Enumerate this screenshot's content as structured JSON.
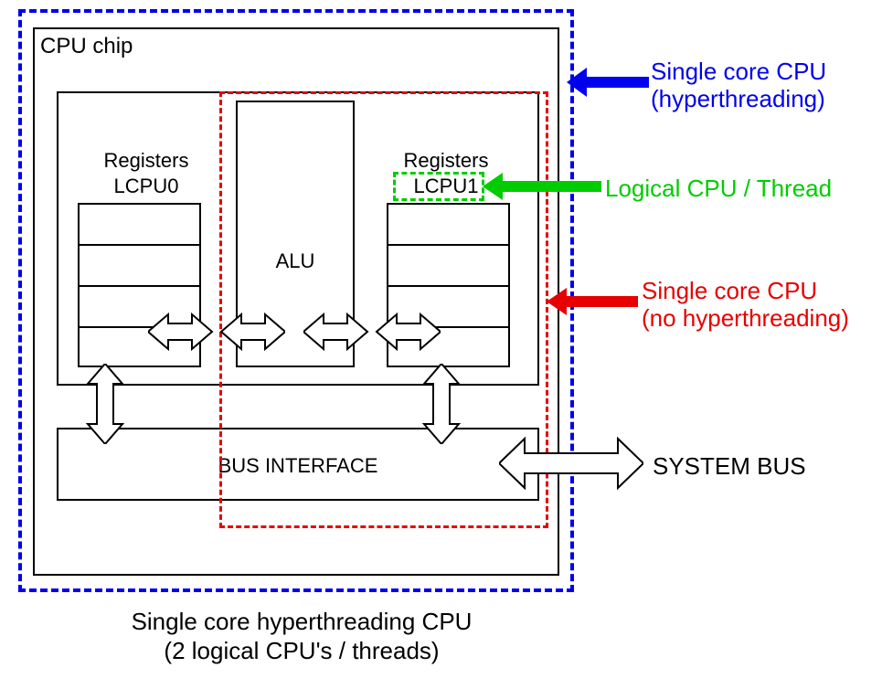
{
  "title": "CPU chip",
  "reg0_label_line1": "Registers",
  "reg0_label_line2": "LCPU0",
  "reg1_label_line1": "Registers",
  "reg1_label_line2": "LCPU1",
  "alu_label": "ALU",
  "bus_interface_label": "BUS INTERFACE",
  "system_bus_label": "SYSTEM BUS",
  "caption_line1": "Single core hyperthreading CPU",
  "caption_line2": "(2 logical CPU's / threads)",
  "annot_blue_line1": "Single core CPU",
  "annot_blue_line2": "(hyperthreading)",
  "annot_green": "Logical CPU / Thread",
  "annot_red_line1": "Single core CPU",
  "annot_red_line2": "(no hyperthreading)"
}
